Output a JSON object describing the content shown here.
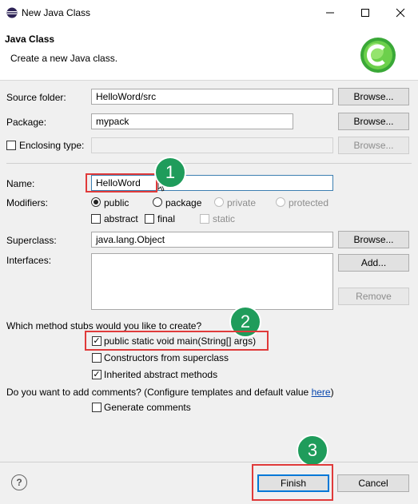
{
  "window": {
    "title": "New Java Class"
  },
  "header": {
    "title": "Java Class",
    "subtitle": "Create a new Java class."
  },
  "form": {
    "source_folder": {
      "label": "Source folder:",
      "value": "HelloWord/src",
      "browse": "Browse..."
    },
    "package": {
      "label": "Package:",
      "value": "mypack",
      "browse": "Browse..."
    },
    "enclosing_type": {
      "label": "Enclosing type:",
      "value": "",
      "browse": "Browse...",
      "checked": false
    },
    "name": {
      "label": "Name:",
      "value": "HelloWord"
    },
    "modifiers": {
      "label": "Modifiers:",
      "radios": [
        "public",
        "package",
        "private",
        "protected"
      ],
      "selected": "public",
      "checks": [
        "abstract",
        "final",
        "static"
      ]
    },
    "superclass": {
      "label": "Superclass:",
      "value": "java.lang.Object",
      "browse": "Browse..."
    },
    "interfaces": {
      "label": "Interfaces:",
      "add": "Add...",
      "remove": "Remove"
    },
    "stubs": {
      "question": "Which method stubs would you like to create?",
      "options": [
        {
          "label": "public static void main(String[] args)",
          "checked": true
        },
        {
          "label": "Constructors from superclass",
          "checked": false
        },
        {
          "label": "Inherited abstract methods",
          "checked": true
        }
      ]
    },
    "comments": {
      "question": "Do you want to add comments? (Configure templates and default value ",
      "link": "here",
      "close": ")",
      "option": "Generate comments",
      "checked": false
    }
  },
  "annotations": [
    "1",
    "2",
    "3"
  ],
  "footer": {
    "help": "?",
    "finish": "Finish",
    "cancel": "Cancel"
  },
  "colors": {
    "badge": "#1f9c5b",
    "highlight": "#e03a3a",
    "accent": "#0078d7"
  }
}
